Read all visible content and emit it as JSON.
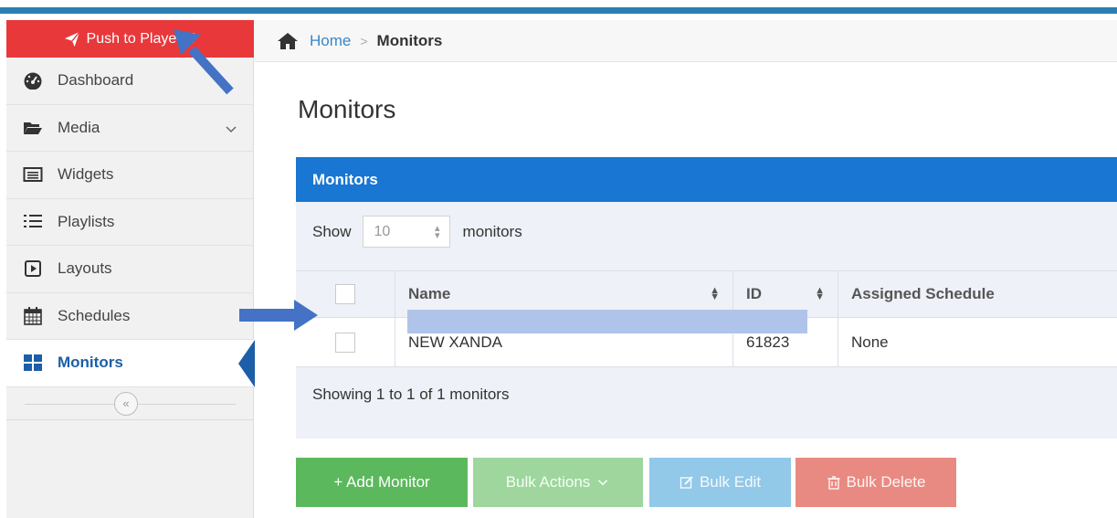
{
  "sidebar": {
    "push_button": "Push to Players?",
    "items": [
      {
        "label": "Dashboard",
        "icon": "dashboard-gauge-icon"
      },
      {
        "label": "Media",
        "icon": "folder-open-icon"
      },
      {
        "label": "Widgets",
        "icon": "widget-window-icon"
      },
      {
        "label": "Playlists",
        "icon": "numbered-list-icon"
      },
      {
        "label": "Layouts",
        "icon": "play-square-icon"
      },
      {
        "label": "Schedules",
        "icon": "calendar-icon"
      },
      {
        "label": "Monitors",
        "icon": "grid-tiles-icon",
        "active": true
      }
    ],
    "collapse_glyph": "«"
  },
  "breadcrumb": {
    "home": "Home",
    "separator": ">",
    "current": "Monitors"
  },
  "page_title": "Monitors",
  "panel": {
    "title": "Monitors",
    "show_label": "Show",
    "page_size": "10",
    "unit_label": "monitors",
    "columns": [
      "Name",
      "ID",
      "Assigned Schedule"
    ],
    "rows": [
      {
        "name": "NEW XANDA",
        "id": "61823",
        "schedule": "None"
      }
    ],
    "showing_text": "Showing 1 to 1 of 1 monitors"
  },
  "actions": {
    "add": "+ Add Monitor",
    "bulk_actions": "Bulk Actions",
    "bulk_edit": "Bulk Edit",
    "bulk_delete": "Bulk Delete"
  },
  "colors": {
    "accent_blue": "#1976d2",
    "push_red": "#e8383a",
    "add_green": "#5cb85c",
    "annotation_arrow": "#4472c4",
    "redaction": "#b0c4ea"
  }
}
